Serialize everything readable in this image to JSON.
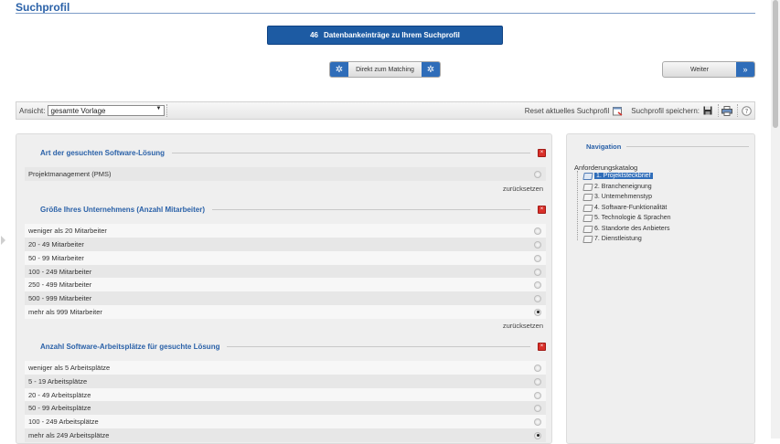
{
  "page": {
    "title": "Suchprofil"
  },
  "results": {
    "count": "46",
    "text": "Datenbankeinträge zu Ihrem Suchprofil"
  },
  "actions": {
    "match_label": "Direkt zum Matching",
    "next_label": "Weiter"
  },
  "toolbar": {
    "view_label": "Ansicht:",
    "view_value": "gesamte Vorlage",
    "reset_label": "Reset aktuelles Suchprofil",
    "save_label": "Suchprofil speichern:"
  },
  "sections": [
    {
      "title": "Art der gesuchten Software-Lösung",
      "options": [
        {
          "label": "Projektmanagement (PMS)",
          "checked": false
        }
      ],
      "reset": "zurücksetzen"
    },
    {
      "title": "Größe Ihres Unternehmens (Anzahl Mitarbeiter)",
      "options": [
        {
          "label": "weniger als 20 Mitarbeiter",
          "checked": false
        },
        {
          "label": "20 - 49 Mitarbeiter",
          "checked": false
        },
        {
          "label": "50 - 99 Mitarbeiter",
          "checked": false
        },
        {
          "label": "100 - 249 Mitarbeiter",
          "checked": false
        },
        {
          "label": "250 - 499 Mitarbeiter",
          "checked": false
        },
        {
          "label": "500 - 999 Mitarbeiter",
          "checked": false
        },
        {
          "label": "mehr als 999 Mitarbeiter",
          "checked": true
        }
      ],
      "reset": "zurücksetzen"
    },
    {
      "title": "Anzahl Software-Arbeitsplätze für gesuchte Lösung",
      "options": [
        {
          "label": "weniger als 5 Arbeitsplätze",
          "checked": false
        },
        {
          "label": "5 - 19 Arbeitsplätze",
          "checked": false
        },
        {
          "label": "20 - 49 Arbeitsplätze",
          "checked": false
        },
        {
          "label": "50 - 99 Arbeitsplätze",
          "checked": false
        },
        {
          "label": "100 - 249 Arbeitsplätze",
          "checked": false
        },
        {
          "label": "mehr als 249 Arbeitsplätze",
          "checked": true
        }
      ]
    }
  ],
  "navigation": {
    "title": "Navigation",
    "catalog_title": "Anforderungskatalog",
    "items": [
      {
        "label": "1. Projektsteckbrief",
        "selected": true
      },
      {
        "label": "2. Brancheneignung",
        "selected": false
      },
      {
        "label": "3. Unternehmenstyp",
        "selected": false
      },
      {
        "label": "4. Software-Funktionalität",
        "selected": false
      },
      {
        "label": "5. Technologie & Sprachen",
        "selected": false
      },
      {
        "label": "6. Standorte des Anbieters",
        "selected": false
      },
      {
        "label": "7. Dienstleistung",
        "selected": false
      }
    ]
  },
  "colors": {
    "accent": "#2a61a8",
    "button_blue": "#1d5ba3",
    "close_red": "#d9302a"
  }
}
